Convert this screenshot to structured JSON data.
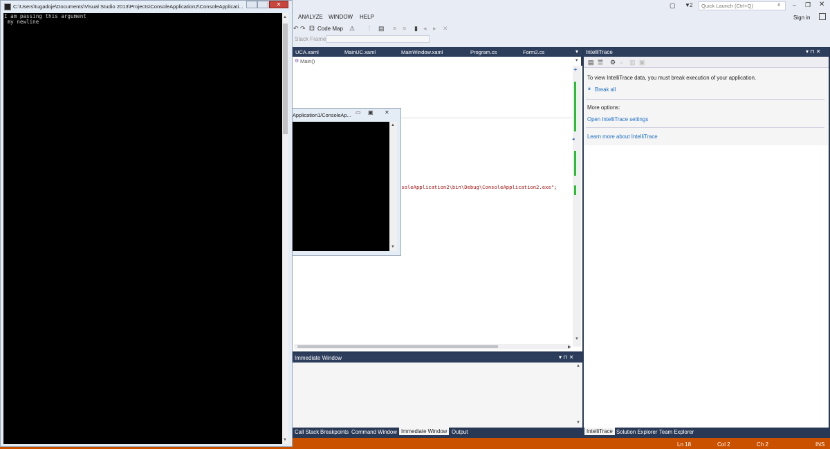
{
  "menu": [
    "ANALYZE",
    "WINDOW",
    "HELP"
  ],
  "top": {
    "notifications_count": "2",
    "quick_launch_placeholder": "Quick Launch (Ctrl+Q)",
    "sign_in": "Sign in"
  },
  "toolbar": {
    "code_map": "Code Map",
    "stack_frame_label": "Stack Frame:"
  },
  "doc_tabs": [
    "UCA.xaml",
    "MainUC.xaml",
    "MainWindow.xaml",
    "Program.cs",
    "Form2.cs"
  ],
  "editor": {
    "nav_method": "Main()",
    "code_line": "nsoleApplication2\\bin\\Debug\\ConsoleApplication2.exe\";"
  },
  "immediate": {
    "title": "Immediate Window",
    "header_buttons": "▾ ⊓ ✕"
  },
  "bottom_tabs": [
    "Call Stack",
    "Breakpoints",
    "Command Window",
    "Immediate Window",
    "Output"
  ],
  "intellitrace": {
    "title": "IntelliTrace",
    "message": "To view IntelliTrace data, you must break execution of your application.",
    "break_all": "Break all",
    "more_options": "More options:",
    "open_settings": "Open IntelliTrace settings",
    "learn_more": "Learn more about IntelliTrace",
    "header_buttons": "▾ ⊓ ✕",
    "tabs": [
      "IntelliTrace",
      "Solution Explorer",
      "Team Explorer"
    ]
  },
  "status": {
    "ln": "Ln 18",
    "col": "Col 2",
    "ch": "Ch 2",
    "ins": "INS"
  },
  "console": {
    "title": "C:\\Users\\tugadoje\\Documents\\Visual Studio 2013\\Projects\\ConsoleApplication2\\ConsoleApplicati...",
    "lines": [
      "I am passing this argument",
      " my newline"
    ],
    "close_glyph": "✕"
  },
  "small_console": {
    "title": "Application1/ConsoleAp..."
  },
  "colors": {
    "status_bar": "#ca5100",
    "dark_chrome": "#2d3e5d",
    "link": "#1e6fc4"
  }
}
